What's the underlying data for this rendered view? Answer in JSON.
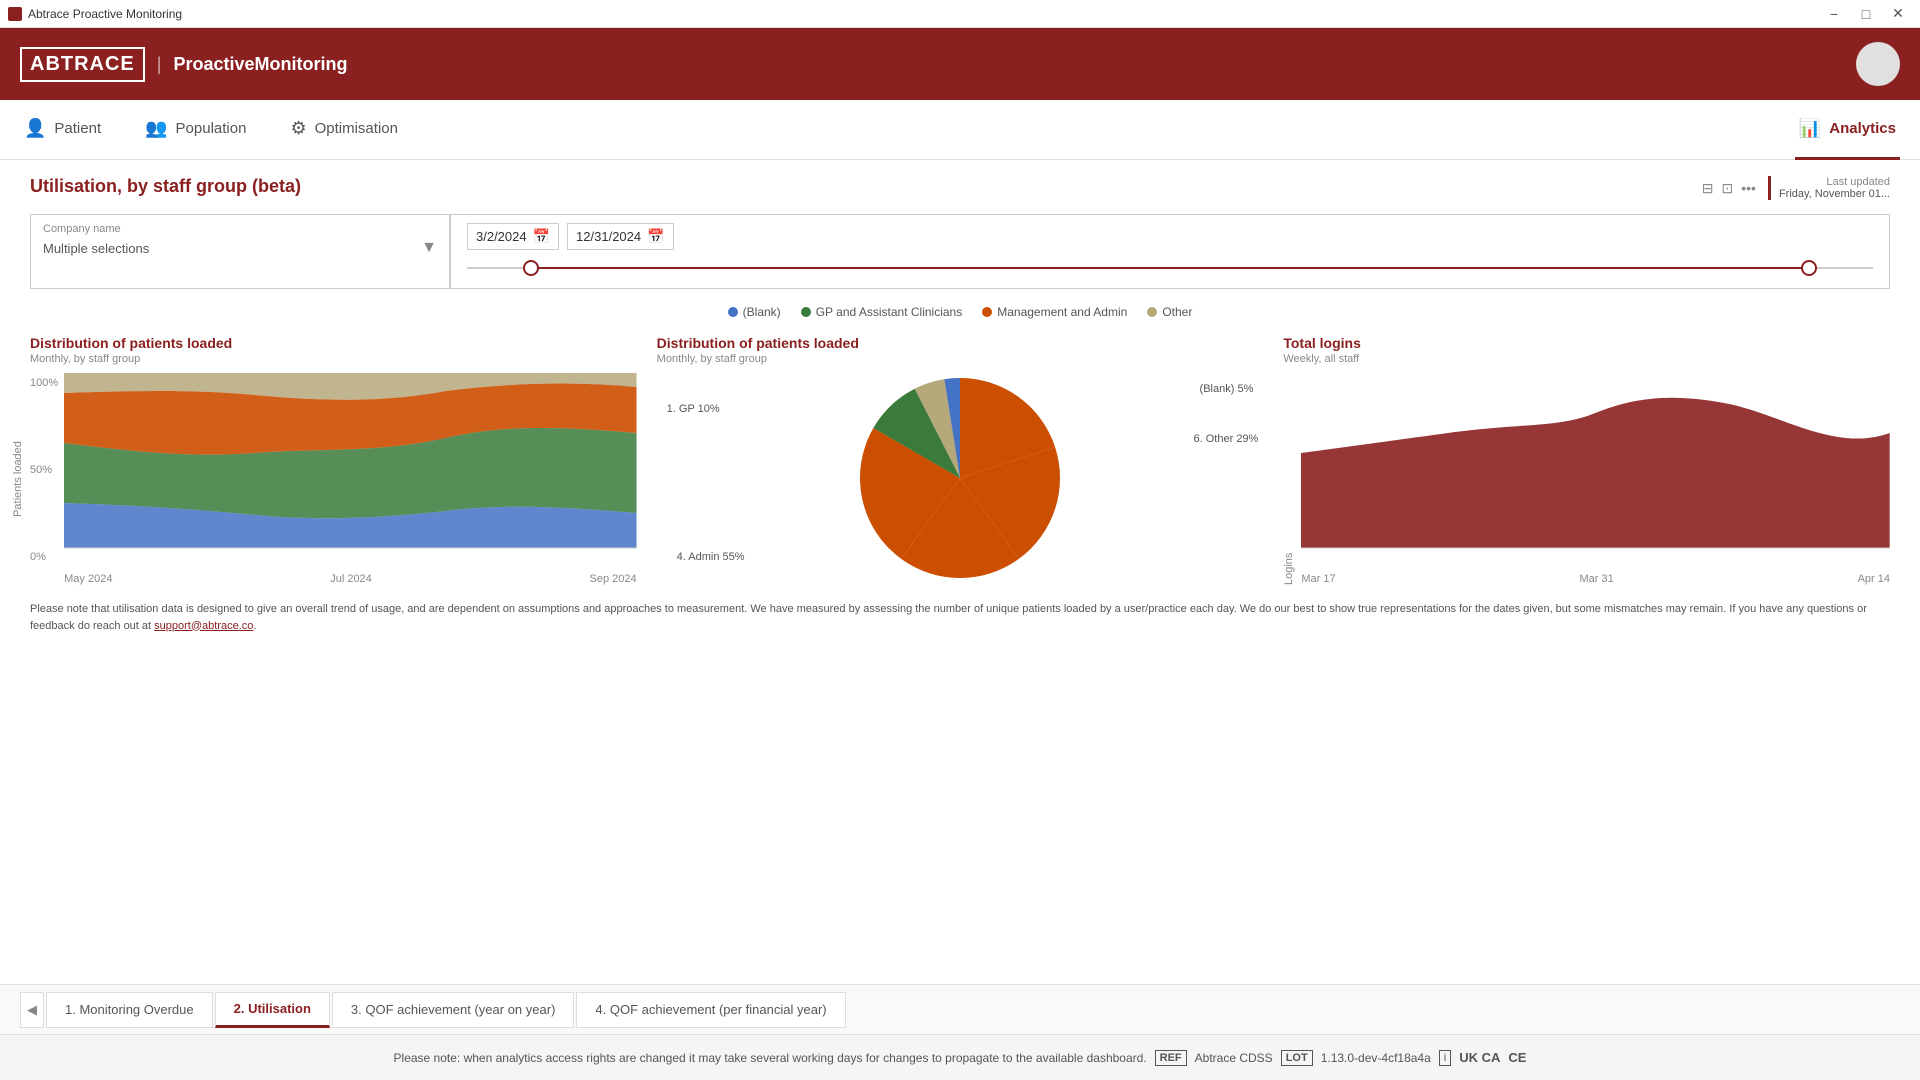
{
  "titleBar": {
    "title": "Abtrace Proactive Monitoring",
    "controls": [
      "minimize",
      "maximize",
      "close"
    ]
  },
  "header": {
    "logoText": "ABTRACE",
    "separator": "|",
    "subtitle": "ProactiveMonitoring",
    "subtitleBold": "Proactive"
  },
  "nav": {
    "items": [
      {
        "id": "patient",
        "label": "Patient",
        "icon": "👤"
      },
      {
        "id": "population",
        "label": "Population",
        "icon": "👥"
      },
      {
        "id": "optimisation",
        "label": "Optimisation",
        "icon": "⚙"
      }
    ],
    "activeItem": {
      "id": "analytics",
      "label": "Analytics",
      "icon": "📊"
    }
  },
  "lastUpdated": {
    "label": "Last updated",
    "value": "Friday, November 01..."
  },
  "pageTitle": "Utilisation, by staff group (beta)",
  "filterToolbar": {
    "filterIcon": "⊟",
    "expandIcon": "⊡",
    "moreIcon": "..."
  },
  "companyFilter": {
    "label": "Company name",
    "value": "Multiple selections"
  },
  "dateRange": {
    "startDate": "3/2/2024",
    "endDate": "12/31/2024"
  },
  "legend": [
    {
      "label": "(Blank)",
      "color": "#4472c4"
    },
    {
      "label": "GP and Assistant Clinicians",
      "color": "#3a7a3a"
    },
    {
      "label": "Management and Admin",
      "color": "#cc4e00"
    },
    {
      "label": "Other",
      "color": "#b5a87a"
    }
  ],
  "areaChart": {
    "title": "Distribution of patients loaded",
    "subtitle": "Monthly, by staff group",
    "yLabels": [
      "100%",
      "50%",
      "0%"
    ],
    "xLabels": [
      "May 2024",
      "Jul 2024",
      "Sep 2024"
    ],
    "yAxisLabel": "Patients loaded"
  },
  "pieChart": {
    "title": "Distribution of patients loaded",
    "subtitle": "Monthly, by staff group",
    "segments": [
      {
        "label": "(Blank) 5%",
        "value": 5,
        "color": "#4472c4"
      },
      {
        "label": "1. GP 10%",
        "value": 10,
        "color": "#3a7a3a"
      },
      {
        "label": "4. Admin 55%",
        "value": 55,
        "color": "#cc4e00"
      },
      {
        "label": "6. Other 29%",
        "value": 29,
        "color": "#b5a87a"
      }
    ]
  },
  "barChart": {
    "title": "Total logins",
    "subtitle": "Weekly, all staff",
    "xLabels": [
      "Mar 17",
      "Mar 31",
      "Apr 14"
    ],
    "yAxisLabel": "Logins"
  },
  "disclaimer": "Please note that utilisation data is designed to give an overall trend of usage, and are dependent on assumptions and approaches to measurement. We have measured by assessing the number of unique patients loaded by a user/practice each day. We do our best to show true representations for the dates given, but some mismatches may remain. If you have any questions or feedback do reach out at support@abtrace.co.",
  "bottomTabs": {
    "tabs": [
      {
        "id": "monitoring-overdue",
        "label": "1. Monitoring Overdue",
        "active": false
      },
      {
        "id": "utilisation",
        "label": "2. Utilisation",
        "active": true
      },
      {
        "id": "qof-year-on-year",
        "label": "3. QOF achievement (year on year)",
        "active": false
      },
      {
        "id": "qof-financial-year",
        "label": "4. QOF achievement (per financial year)",
        "active": false
      }
    ]
  },
  "footer": {
    "notice": "Please note: when analytics access rights are changed it may take several working days for changes to propagate to the available dashboard.",
    "ref": "REF",
    "refValue": "Abtrace CDSS",
    "lot": "LOT",
    "lotValue": "1.13.0-dev-4cf18a4a",
    "ce": "CE",
    "ukca": "UK CA"
  }
}
